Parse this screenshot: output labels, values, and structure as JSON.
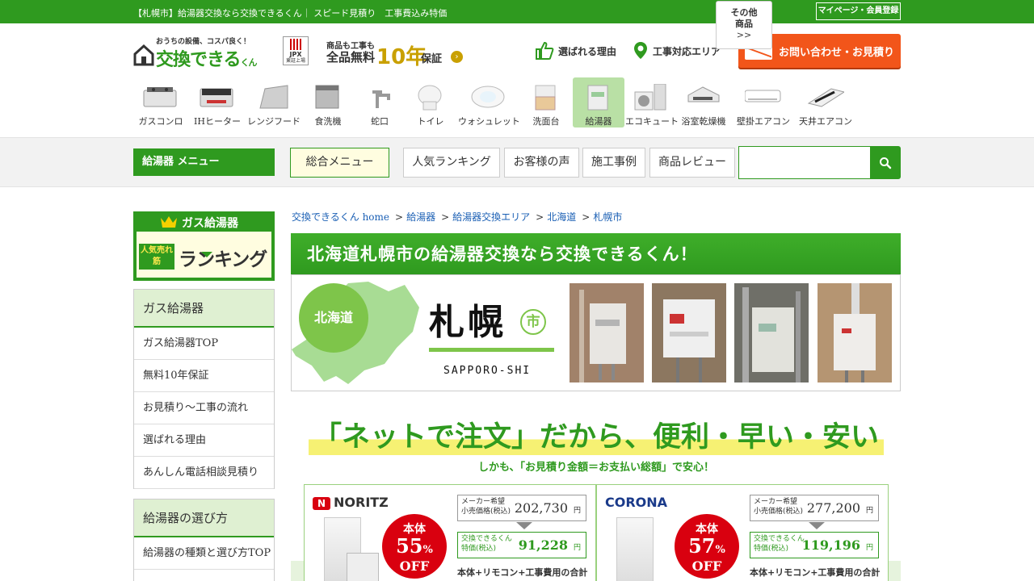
{
  "topbar": {
    "text": "【札幌市】給湯器交換なら交換できるくん｜ スピード見積り　工事費込み特価",
    "mypage": "マイページ・会員登録"
  },
  "header": {
    "logo_tagline": "おうちの設備、コスパ良く！",
    "logo_name": "交換できる",
    "logo_suffix": "くん",
    "jpx": "JPX",
    "jpx_sub": "東証上場",
    "warranty_line1": "商品も工事も",
    "warranty_line2": "全品無料",
    "warranty_years": "10年",
    "warranty_line3": "保証",
    "nav_reason": "選ばれる理由",
    "nav_area": "工事対応エリア",
    "contact": "お問い合わせ・お見積り"
  },
  "categories": [
    {
      "label": "ガスコンロ",
      "icon": "gas-stove-icon"
    },
    {
      "label": "IHヒーター",
      "icon": "ih-heater-icon"
    },
    {
      "label": "レンジフード",
      "icon": "range-hood-icon"
    },
    {
      "label": "食洗機",
      "icon": "dishwasher-icon"
    },
    {
      "label": "蛇口",
      "icon": "faucet-icon"
    },
    {
      "label": "トイレ",
      "icon": "toilet-icon"
    },
    {
      "label": "ウォシュレット",
      "icon": "washlet-icon"
    },
    {
      "label": "洗面台",
      "icon": "vanity-icon"
    },
    {
      "label": "給湯器",
      "icon": "water-heater-icon",
      "active": true
    },
    {
      "label": "エコキュート",
      "icon": "ecocute-icon"
    },
    {
      "label": "浴室乾燥機",
      "icon": "bath-dryer-icon"
    },
    {
      "label": "壁掛エアコン",
      "icon": "wall-aircon-icon"
    },
    {
      "label": "天井エアコン",
      "icon": "ceiling-aircon-icon"
    }
  ],
  "category_other": {
    "line1": "その他",
    "line2": "商品",
    "line3": ">>"
  },
  "menubar": {
    "label": "給湯器 メニュー",
    "tabs": [
      "総合メニュー",
      "人気ランキング",
      "お客様の声",
      "施工事例",
      "商品レビュー"
    ],
    "search_placeholder": ""
  },
  "sidebar": {
    "ranking_title": "ガス給湯器",
    "ranking_badge": "人気売れ筋",
    "ranking_text": "ランキング",
    "box1": {
      "head": "ガス給湯器",
      "items": [
        "ガス給湯器TOP",
        "無料10年保証",
        "お見積り～工事の流れ",
        "選ばれる理由",
        "あんしん電話相談見積り"
      ]
    },
    "box2": {
      "head": "給湯器の選び方",
      "items": [
        "給湯器の種類と選び方TOP"
      ]
    }
  },
  "breadcrumb": [
    "交換できるくん home",
    "給湯器",
    "給湯器交換エリア",
    "北海道",
    "札幌市"
  ],
  "main": {
    "title": "北海道札幌市の給湯器交換なら交換できるくん！",
    "pref": "北海道",
    "city": "札幌",
    "city_suffix": "市",
    "city_roman": "SAPPORO-SHI",
    "catch_big": "「ネットで注文」だから、便利・早い・安い",
    "catch_small": "しかも、「お見積り金額＝お支払い総額」で安心！"
  },
  "products": [
    {
      "brand": "NORITZ",
      "discount_label": "本体",
      "discount": "55",
      "list_label1": "メーカー希望",
      "list_label2": "小売価格(税込)",
      "list_price": "202,730",
      "sp_label1": "交換できるくん",
      "sp_label2": "特価(税込)",
      "sp_price": "91,228",
      "yen": "円",
      "note": "本体+リモコン+工事費用の合計"
    },
    {
      "brand": "CORONA",
      "discount_label": "本体",
      "discount": "57",
      "list_label1": "メーカー希望",
      "list_label2": "小売価格(税込)",
      "list_price": "277,200",
      "sp_label1": "交換できるくん",
      "sp_label2": "特価(税込)",
      "sp_price": "119,196",
      "yen": "円",
      "note": "本体+リモコン+工事費用の合計"
    }
  ],
  "colors": {
    "brand_green": "#2f9a1f",
    "accent_orange": "#f2551a",
    "discount_red": "#d9000f",
    "light_green": "#7ec54a"
  }
}
